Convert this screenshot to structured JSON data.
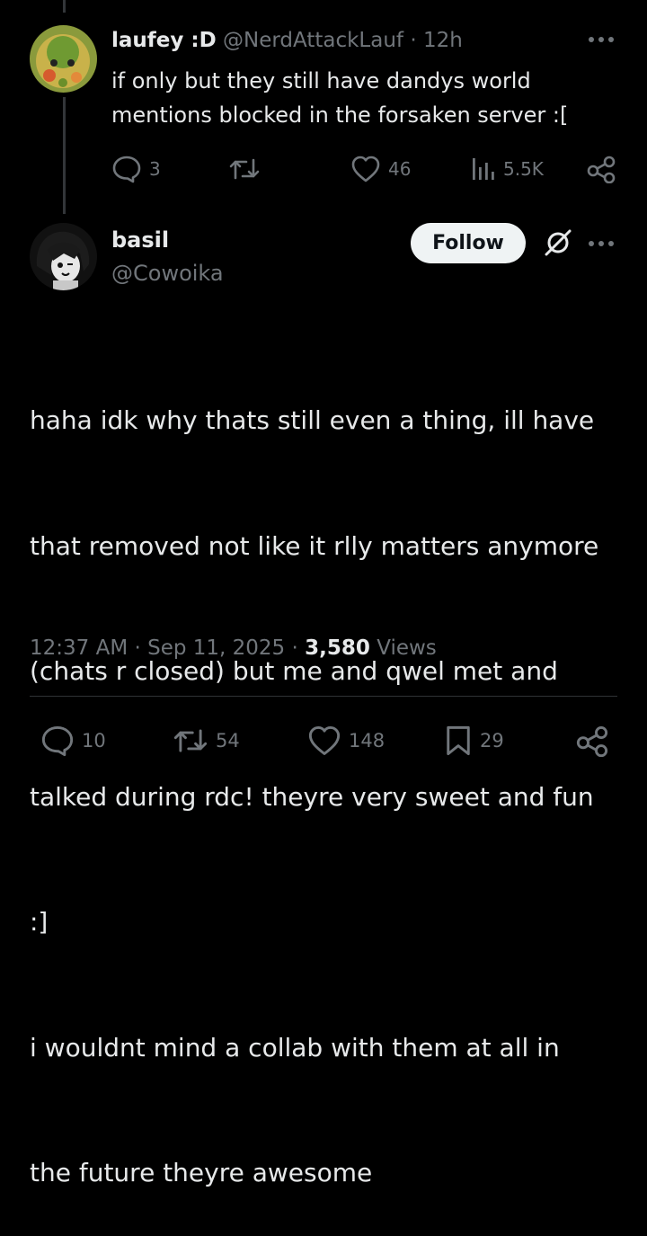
{
  "reply": {
    "display_name": "laufey :D",
    "handle": "@NerdAttackLauf",
    "separator": "·",
    "time": "12h",
    "text_line1": "if only but they still have dandys world",
    "text_line2": "mentions blocked in the forsaken server :[",
    "stats": {
      "replies": "3",
      "likes": "46",
      "views": "5.5K"
    }
  },
  "main": {
    "display_name": "basil",
    "handle": "@Cowoika",
    "follow_label": "Follow",
    "text_lines": [
      "haha idk why thats still even a thing, ill have",
      "that removed not like it rlly matters anymore",
      "(chats r closed) but me and qwel met and",
      "talked during rdc! theyre very sweet and fun",
      ":]",
      "i wouldnt mind a collab with them at all in",
      "the future theyre awesome"
    ],
    "meta": {
      "time": "12:37 AM",
      "dot": "·",
      "date": "Sep 11, 2025",
      "views_count": "3,580",
      "views_label": "Views"
    },
    "stats": {
      "replies": "10",
      "reposts": "54",
      "likes": "148",
      "bookmarks": "29"
    }
  },
  "colors": {
    "background": "#000000",
    "text": "#e7e9ea",
    "muted": "#71767b",
    "follow_bg": "#eff3f4"
  }
}
